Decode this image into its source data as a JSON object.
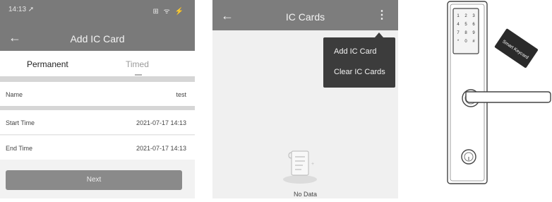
{
  "add_ic_card": {
    "status": {
      "time": "14:13 ➚",
      "icons": "⊞ ᯤ ⚡"
    },
    "title": "Add IC Card",
    "tabs": [
      "Permanent",
      "Timed"
    ],
    "rows": [
      {
        "label": "Name",
        "value": "test"
      },
      {
        "label": "Start Time",
        "value": "2021-07-17 14:13"
      },
      {
        "label": "End Time",
        "value": "2021-07-17 14:13"
      }
    ],
    "next_label": "Next"
  },
  "ic_cards": {
    "title": "IC Cards",
    "menu": [
      "Add IC Card",
      "Clear IC Cards"
    ],
    "empty_text": "No Data"
  },
  "device": {
    "keycard_label": "Smart Keycard",
    "keypad": [
      "1",
      "2",
      "3",
      "4",
      "5",
      "6",
      "7",
      "8",
      "9",
      "*",
      "0",
      "#"
    ]
  },
  "icons": {
    "back": "back-arrow-icon",
    "more": "more-vertical-icon",
    "empty": "empty-document-icon"
  }
}
